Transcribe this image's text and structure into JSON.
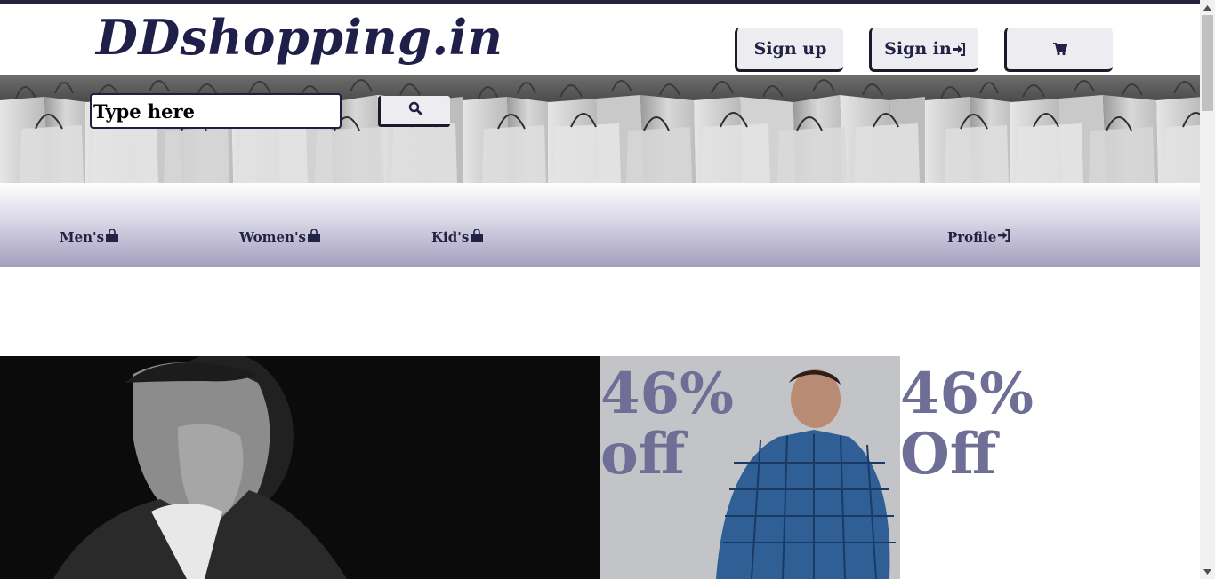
{
  "header": {
    "brand": "DDshopping.in",
    "signup_label": "Sign up",
    "signin_label": "Sign in",
    "signin_icon": "sign-in-icon",
    "cart_icon": "cart-icon"
  },
  "search": {
    "placeholder": "Type here",
    "button_icon": "search-icon"
  },
  "nav": {
    "items": [
      {
        "label": "Men's",
        "icon": "shopping-bag-icon"
      },
      {
        "label": "Women's",
        "icon": "shopping-bag-icon"
      },
      {
        "label": "Kid's",
        "icon": "shopping-bag-icon"
      },
      {
        "label": "Profile",
        "icon": "sign-in-icon"
      }
    ]
  },
  "promo": {
    "banner_mid": [
      "46%",
      "off"
    ],
    "banner_right": [
      "46%",
      "Off"
    ]
  },
  "colors": {
    "brand": "#1f1f4a",
    "top_strip": "#23233f",
    "promo_text": "#6e6e96",
    "nav_gradient_end": "#a39dbd"
  }
}
